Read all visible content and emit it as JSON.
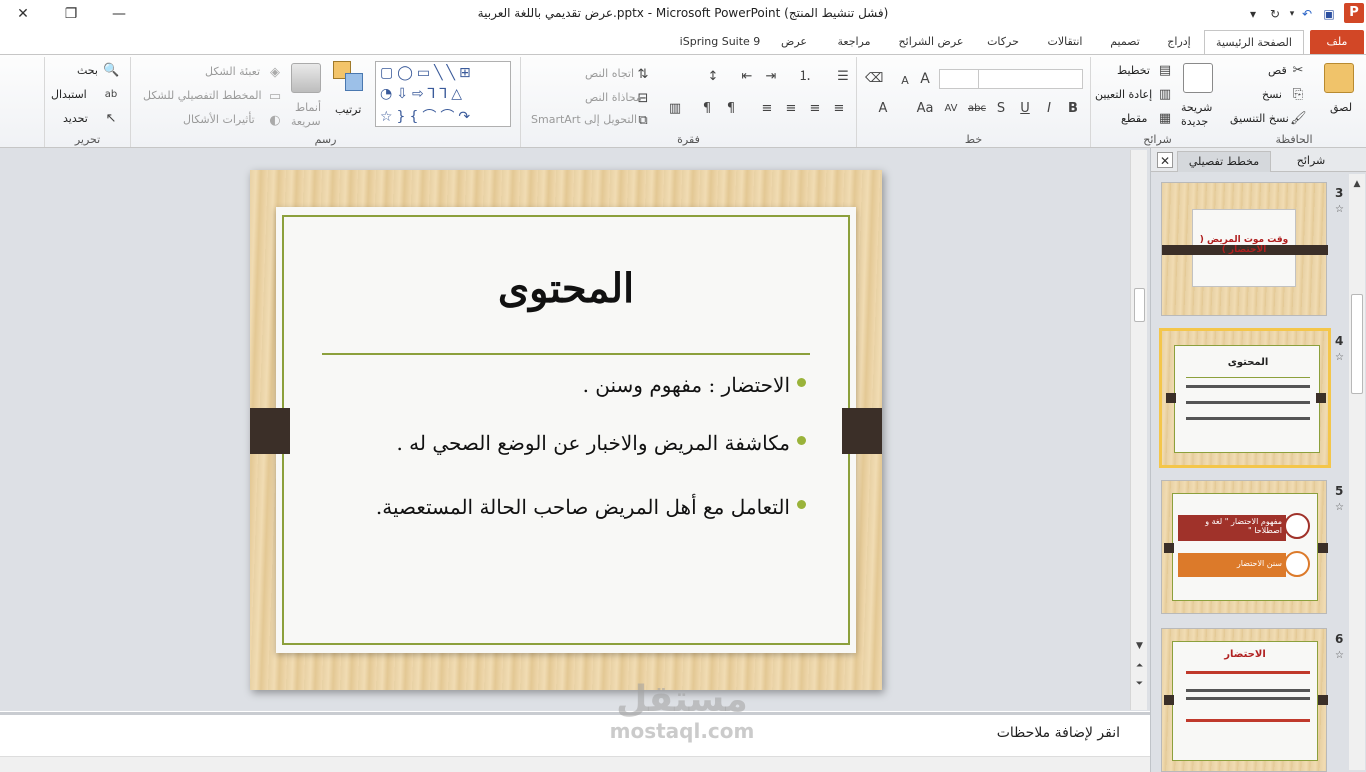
{
  "window": {
    "title": "عرض تقديمي باللغة العربية.pptx - Microsoft PowerPoint (فشل تنشيط المنتج)",
    "close_glyph": "✕",
    "restore_glyph": "❐",
    "minimize_glyph": "—"
  },
  "app_icon_letter": "P",
  "tabs": {
    "file": "ملف",
    "home": "الصفحة الرئيسية",
    "insert": "إدراج",
    "design": "تصميم",
    "transitions": "انتقالات",
    "animations": "حركات",
    "slideshow": "عرض الشرائح",
    "review": "مراجعة",
    "view": "عرض",
    "ispring": "iSpring Suite 9"
  },
  "ribbon": {
    "clipboard": {
      "label": "الحافظة",
      "paste": "لصق",
      "cut": "قص",
      "copy": "نسخ",
      "format_painter": "نسخ التنسيق"
    },
    "slides": {
      "label": "شرائح",
      "new_slide_line1": "شريحة",
      "new_slide_line2": "جديدة",
      "layout": "تخطيط",
      "reset": "إعادة التعيين",
      "section": "مقطع"
    },
    "font": {
      "label": "خط",
      "bold": "B",
      "italic": "I",
      "underline": "U",
      "shadow": "S",
      "strike": "abc",
      "spacing": "AV",
      "case": "Aa",
      "color": "A",
      "grow": "A",
      "shrink": "A"
    },
    "paragraph": {
      "label": "فقرة",
      "text_direction": "اتجاه النص",
      "align_text": "محاذاة النص",
      "smartart": "التحويل إلى SmartArt"
    },
    "drawing": {
      "label": "رسم",
      "arrange": "ترتيب",
      "quick_styles_line1": "أنماط",
      "quick_styles_line2": "سريعة",
      "shape_fill": "تعبئة الشكل",
      "shape_outline": "المخطط التفصيلي للشكل",
      "shape_effects": "تأثيرات الأشكال"
    },
    "editing": {
      "label": "تحرير",
      "find": "بحث",
      "replace": "استبدال",
      "select": "تحديد"
    }
  },
  "slide": {
    "title": "المحتوى",
    "bullets": [
      "الاحتضار : مفهوم وسنن .",
      "مكاشفة المريض والاخبار عن الوضع الصحي له .",
      "التعامل مع أهل المريض صاحب الحالة المستعصية."
    ]
  },
  "notes": {
    "placeholder": "انقر لإضافة ملاحظات"
  },
  "watermark": {
    "line1": "مستقل",
    "line2": "mostaql.com"
  },
  "panel": {
    "tab_slides": "شرائح",
    "tab_outline": "مخطط تفصيلي",
    "close_glyph": "✕",
    "thumbnails": [
      {
        "num": "3",
        "title": "وقت موت المريض ( الاحتضار )"
      },
      {
        "num": "4",
        "title": "المحتوى"
      },
      {
        "num": "5",
        "box1": "مفهوم الاحتضار \" لغة و اصطلاحا \"",
        "box2": "سنن الاحتضار"
      },
      {
        "num": "6",
        "title": "الاحتضار"
      }
    ]
  },
  "colors": {
    "file_tab": "#d24726",
    "accent_green": "#8ca03c",
    "clip_brown": "#3b2f28",
    "selection": "#f4c64a"
  }
}
